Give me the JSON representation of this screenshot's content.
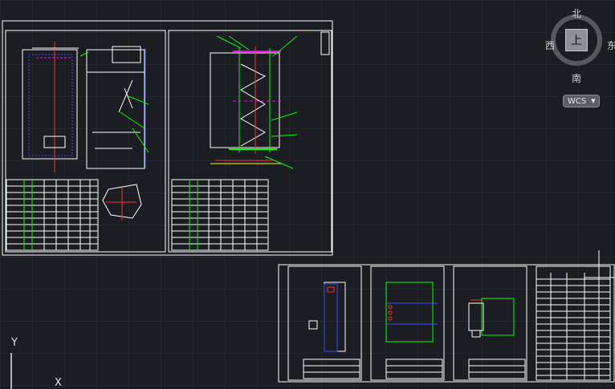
{
  "viewcube": {
    "north": "北",
    "south": "南",
    "west": "西",
    "east": "东",
    "face": "上",
    "wcs_label": "WCS",
    "wcs_caret": "▼"
  },
  "ucs": {
    "y_label": "Y",
    "x_label": "X"
  },
  "colors": {
    "background": "#1b1d22",
    "grid": "#2a2d33",
    "sheet": "#ffffff",
    "green": "#00ff00",
    "magenta": "#ff00ff",
    "red": "#ff3030",
    "blue": "#3050ff",
    "yellow": "#ffff00"
  }
}
